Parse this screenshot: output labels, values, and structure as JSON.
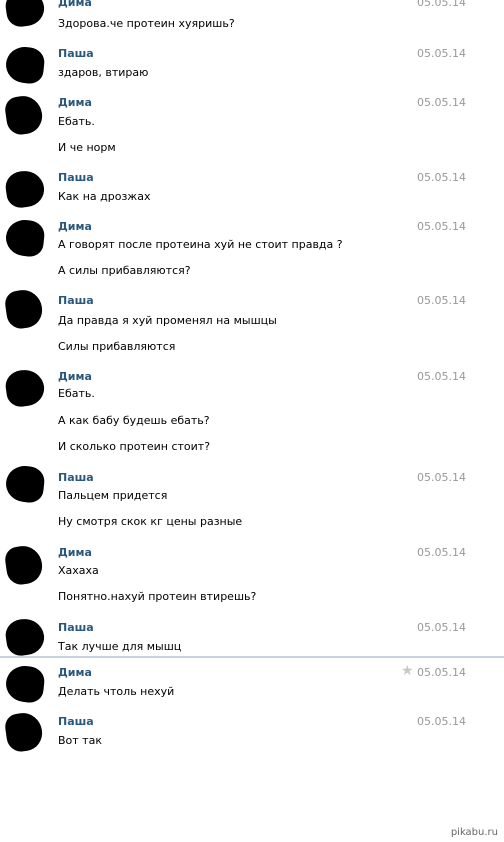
{
  "messages": [
    {
      "author": "Дима",
      "date": "05.05.14",
      "lines": [
        "Здорова.че протеин хуяришь?"
      ]
    },
    {
      "author": "Паша",
      "date": "05.05.14",
      "lines": [
        "здаров, втираю"
      ]
    },
    {
      "author": "Дима",
      "date": "05.05.14",
      "lines": [
        "Ебать.",
        "И че норм"
      ]
    },
    {
      "author": "Паша",
      "date": "05.05.14",
      "lines": [
        "Как на дрозжах"
      ]
    },
    {
      "author": "Дима",
      "date": "05.05.14",
      "lines": [
        "А говорят после протеина хуй не стоит правда ?",
        "А силы прибавляются?"
      ]
    },
    {
      "author": "Паша",
      "date": "05.05.14",
      "lines": [
        "Да правда я хуй променял на мышцы",
        "Силы прибавляются"
      ]
    },
    {
      "author": "Дима",
      "date": "05.05.14",
      "lines": [
        "Ебать.",
        "А как бабу будешь ебать?",
        "И сколько протеин стоит?"
      ]
    },
    {
      "author": "Паша",
      "date": "05.05.14",
      "lines": [
        "Пальцем придется",
        "Ну смотря скок кг цены разные"
      ]
    },
    {
      "author": "Дима",
      "date": "05.05.14",
      "lines": [
        "Хахаха",
        "Понятно.нахуй протеин втирешь?"
      ]
    },
    {
      "author": "Паша",
      "date": "05.05.14",
      "lines": [
        "Так лучше для мышц"
      ]
    },
    {
      "author": "Дима",
      "date": "05.05.14",
      "lines": [
        "Делать чтоль нехуй"
      ]
    },
    {
      "author": "Паша",
      "date": "05.05.14",
      "lines": [
        "Вот так"
      ]
    }
  ],
  "icons": {
    "star": "star-icon"
  },
  "watermark": "pikabu.ru"
}
